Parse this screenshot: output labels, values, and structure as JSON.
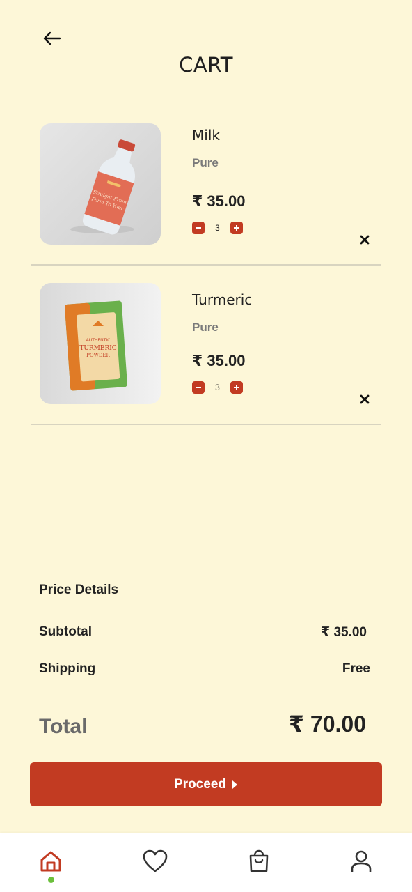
{
  "header": {
    "title": "CART",
    "back_icon": "arrow-left-icon"
  },
  "cart": {
    "currency_symbol": "₹",
    "items": [
      {
        "name": "Milk",
        "variant": "Pure",
        "price": "₹ 35.00",
        "quantity": "3",
        "image": "milk-bottle-image"
      },
      {
        "name": "Turmeric",
        "variant": "Pure",
        "price": "₹ 35.00",
        "quantity": "3",
        "image": "turmeric-powder-pack-image"
      }
    ]
  },
  "price_details": {
    "title": "Price Details",
    "subtotal_label": "Subtotal",
    "subtotal_value": "₹ 35.00",
    "shipping_label": "Shipping",
    "shipping_value": "Free",
    "total_label": "Total",
    "total_value": "₹ 70.00"
  },
  "actions": {
    "proceed_label": "Proceed"
  },
  "bottom_nav": {
    "items": [
      "home-icon",
      "heart-icon",
      "shopping-bag-icon",
      "user-icon"
    ],
    "active": "home-icon",
    "active_color": "#C23B22",
    "indicator_color": "#6BBF3B"
  },
  "colors": {
    "background": "#FDF7D8",
    "accent": "#C23B22"
  }
}
